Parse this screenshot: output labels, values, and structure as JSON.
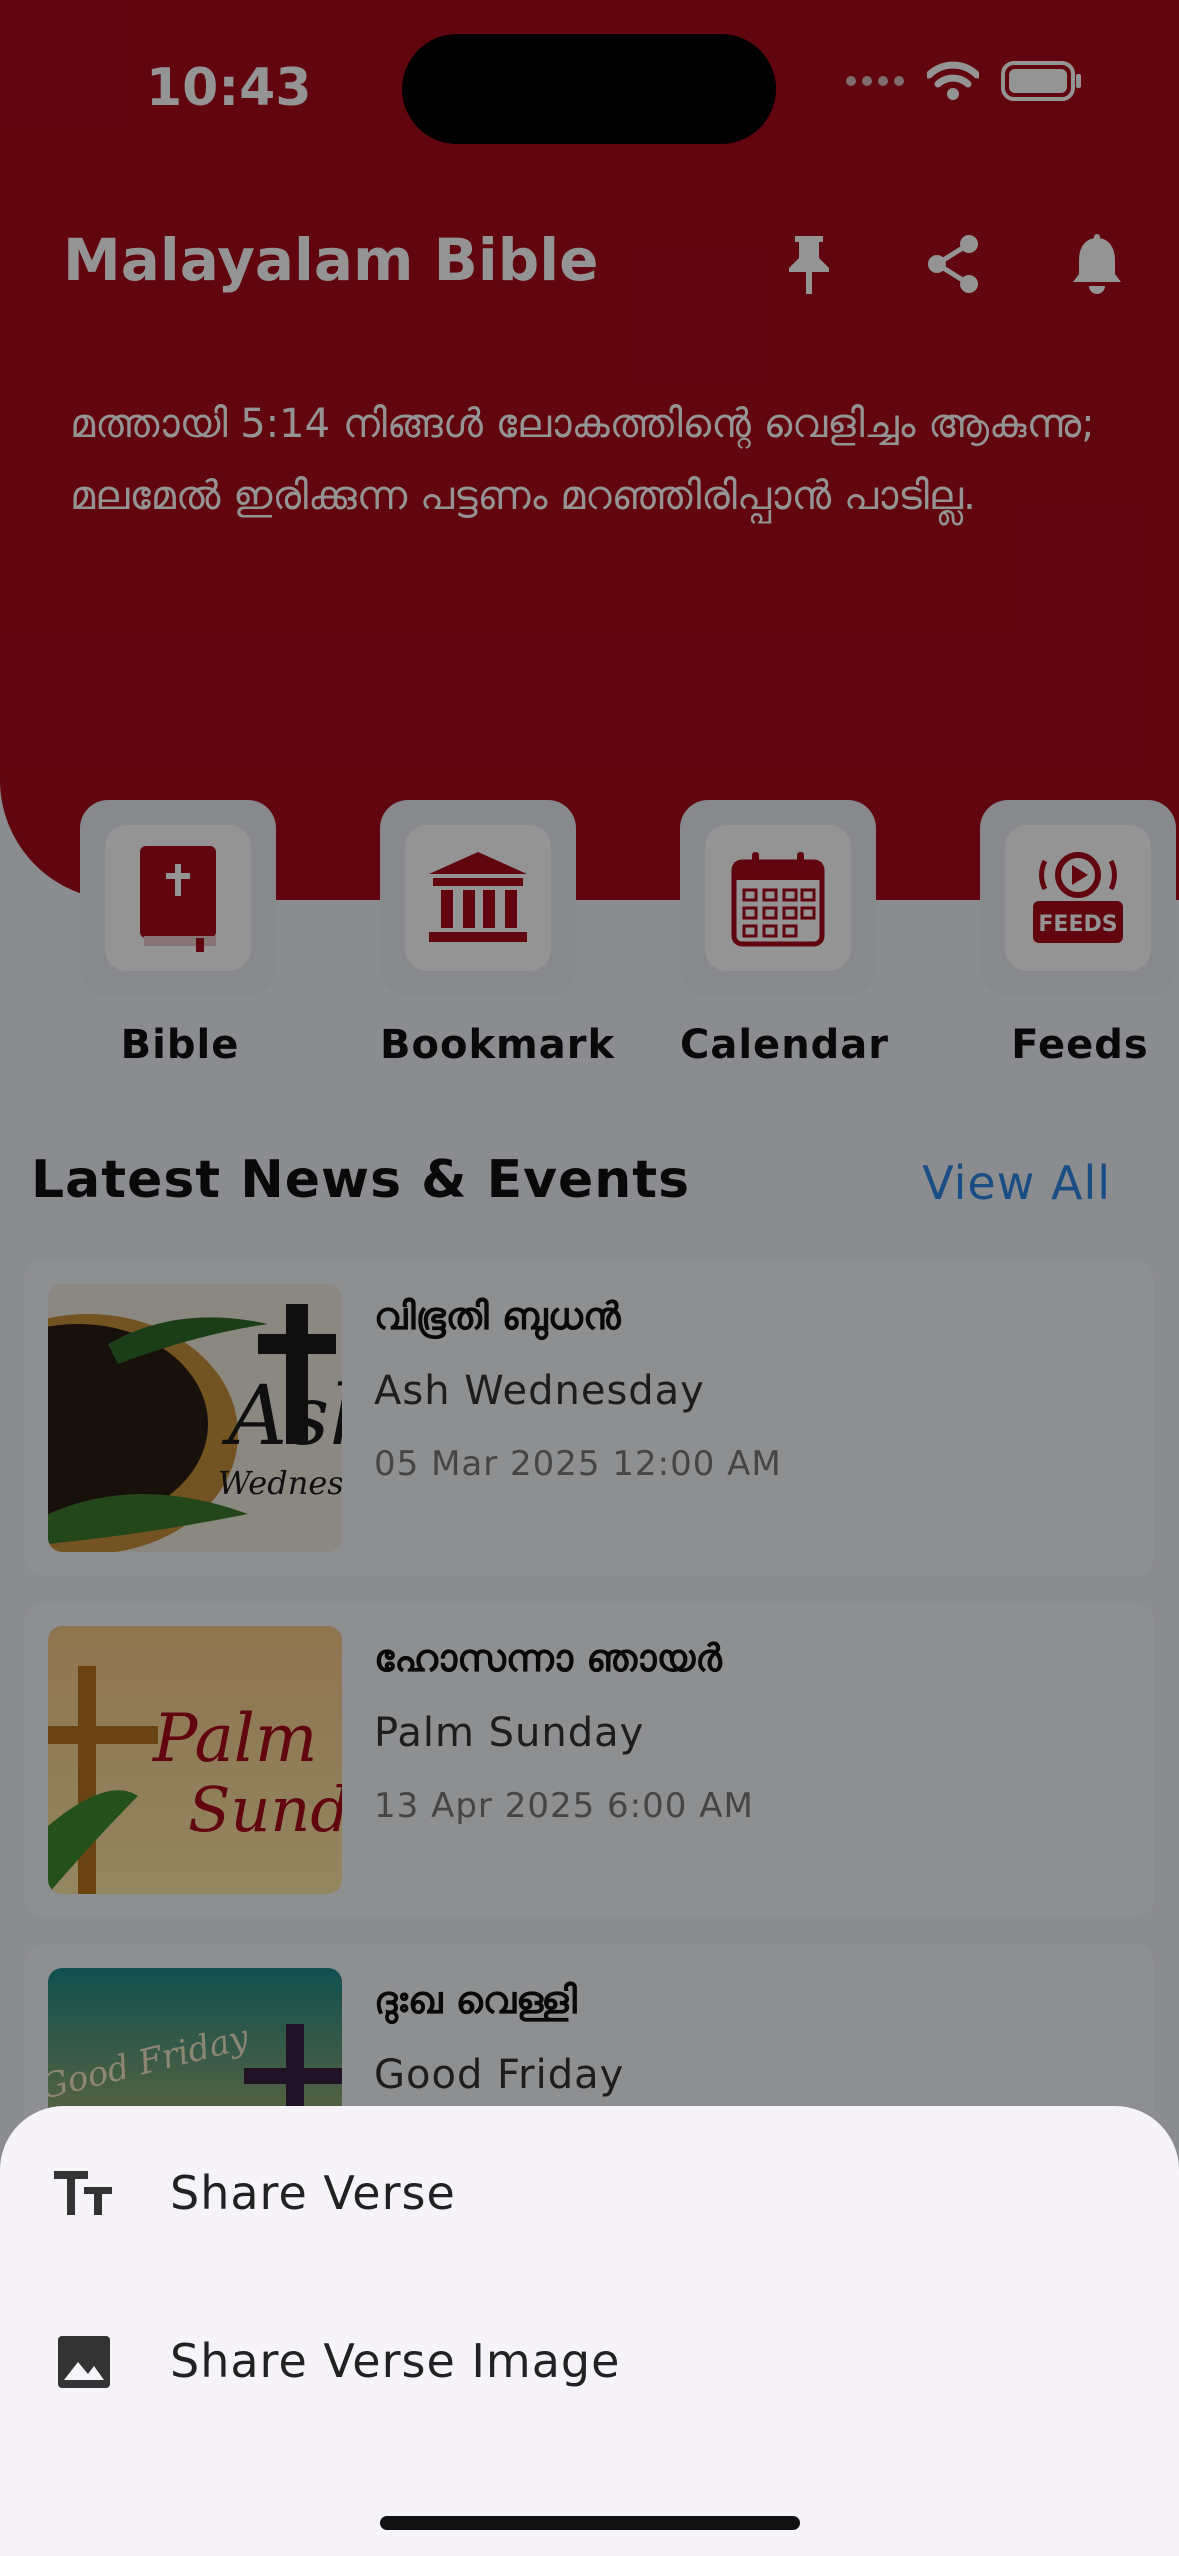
{
  "status_bar": {
    "time": "10:43",
    "icons": [
      "signal-dots-icon",
      "wifi-icon",
      "battery-icon"
    ]
  },
  "header": {
    "title": "Malayalam Bible",
    "actions": [
      {
        "name": "pin-icon"
      },
      {
        "name": "share-icon"
      },
      {
        "name": "bell-icon"
      }
    ],
    "verse": "മത്തായി 5:14 നിങ്ങൾ ലോകത്തിന്റെ വെളിച്ചം ആകുന്നു; മലമേൽ ഇരിക്കുന്ന പട്ടണം മറഞ്ഞിരിപ്പാൻ പാടില്ല."
  },
  "quick_actions": [
    {
      "label": "Bible",
      "icon": "bible-book-icon"
    },
    {
      "label": "Bookmark",
      "icon": "church-building-icon"
    },
    {
      "label": "Calendar",
      "icon": "calendar-icon"
    },
    {
      "label": "Feeds",
      "icon": "feeds-icon",
      "badge": "FEEDS"
    }
  ],
  "news": {
    "title": "Latest News & Events",
    "view_all": "View All",
    "items": [
      {
        "title": "വിഭൂതി ബുധൻ",
        "subtitle": "Ash Wednesday",
        "date": "05 Mar 2025 12:00 AM",
        "thumb_text": "Ash",
        "thumb_text2": "Wednesd"
      },
      {
        "title": "ഹോസന്നാ ഞായർ",
        "subtitle": "Palm Sunday",
        "date": "13 Apr 2025 6:00 AM",
        "thumb_text": "Palm",
        "thumb_text2": "Sunday"
      },
      {
        "title": "ദുഃഖ വെള്ളി",
        "subtitle": "Good Friday",
        "date": "",
        "thumb_text": "Good Friday"
      }
    ]
  },
  "share_sheet": {
    "options": [
      {
        "label": "Share Verse",
        "icon": "text-format-icon"
      },
      {
        "label": "Share Verse Image",
        "icon": "image-icon"
      }
    ]
  },
  "colors": {
    "primary": "#a7091b",
    "link": "#2b86e4",
    "sheet_bg": "#f6f3f9"
  }
}
